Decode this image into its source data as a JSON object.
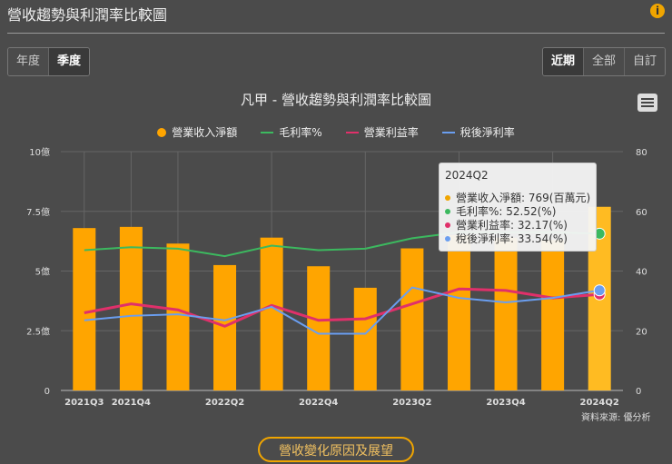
{
  "header": {
    "title": "營收趨勢與利潤率比較圖",
    "info_icon": "i"
  },
  "period_tabs": [
    {
      "label": "年度",
      "active": false
    },
    {
      "label": "季度",
      "active": true
    }
  ],
  "range_tabs": [
    {
      "label": "近期",
      "active": true
    },
    {
      "label": "全部",
      "active": false
    },
    {
      "label": "自訂",
      "active": false
    }
  ],
  "source": "資料來源: 優分析",
  "cta_label": "營收變化原因及展望",
  "tooltip": {
    "title": "2024Q2",
    "rows": [
      {
        "text": "營業收入淨額: 769(百萬元)",
        "color": "#f0a500"
      },
      {
        "text": "毛利率%: 52.52(%)",
        "color": "#3cb95f"
      },
      {
        "text": "營業利益率: 32.17(%)",
        "color": "#e0306a"
      },
      {
        "text": "稅後淨利率: 33.54(%)",
        "color": "#6a9ef0"
      }
    ]
  },
  "chart_data": {
    "type": "bar+line",
    "title": "凡甲 - 營收趨勢與利潤率比較圖",
    "categories": [
      "2021Q3",
      "2021Q4",
      "2022Q1",
      "2022Q2",
      "2022Q3",
      "2022Q4",
      "2023Q1",
      "2023Q2",
      "2023Q3",
      "2023Q4",
      "2024Q1",
      "2024Q2"
    ],
    "x_tick_labels": [
      "2021Q3",
      "2021Q4",
      "",
      "2022Q2",
      "",
      "2022Q4",
      "",
      "2023Q2",
      "",
      "2023Q4",
      "",
      "2024Q2"
    ],
    "left_axis": {
      "ticks": [
        "0",
        "2.5億",
        "5億",
        "7.5億",
        "10億"
      ],
      "range": [
        0,
        10
      ],
      "unit": "億"
    },
    "right_axis": {
      "ticks": [
        "0",
        "20",
        "40",
        "60",
        "80"
      ],
      "range": [
        0,
        80
      ]
    },
    "series": [
      {
        "name": "營業收入淨額",
        "type": "bar",
        "axis": "left",
        "color": "#ffa500",
        "values": [
          6.8,
          6.85,
          6.15,
          5.25,
          6.4,
          5.2,
          4.3,
          5.95,
          6.5,
          6.4,
          6.3,
          7.69
        ]
      },
      {
        "name": "毛利率%",
        "type": "line",
        "axis": "right",
        "color": "#3cb95f",
        "values": [
          47,
          48,
          47.5,
          45,
          48.5,
          47,
          47.5,
          51,
          53,
          53,
          53,
          52.52
        ]
      },
      {
        "name": "營業利益率",
        "type": "line",
        "axis": "right",
        "color": "#e0306a",
        "values": [
          26,
          29,
          27,
          21.5,
          28.5,
          23.5,
          24,
          29,
          34,
          33.5,
          31,
          32.17
        ]
      },
      {
        "name": "稅後淨利率",
        "type": "line",
        "axis": "right",
        "color": "#6a9ef0",
        "values": [
          23.5,
          25,
          25.5,
          23.5,
          28,
          19,
          19,
          34.5,
          31,
          29.5,
          31,
          33.54
        ]
      }
    ],
    "grid": true,
    "legend_position": "top"
  }
}
